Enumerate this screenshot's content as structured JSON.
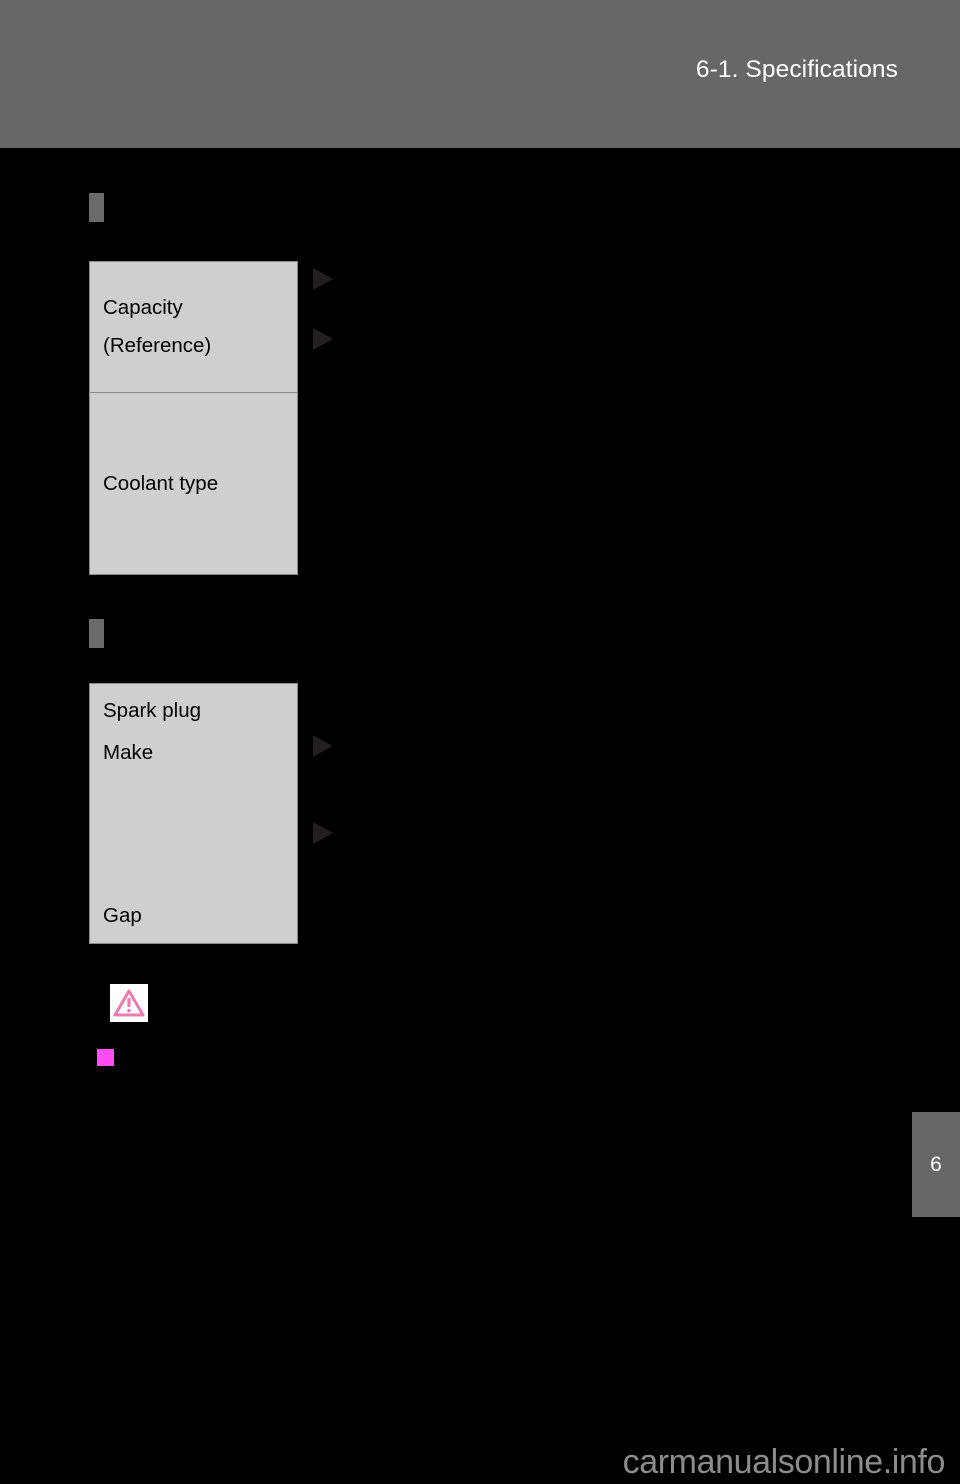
{
  "page": {
    "header_title": "6-1. Specifications",
    "chapter_tab": "6",
    "watermark": "carmanualsonline.info"
  },
  "sections": [
    {
      "id": "cooling-system",
      "marker": "",
      "rows": [
        {
          "label_line1": "Capacity",
          "label_line2": "(Reference)"
        },
        {
          "label_line1": "Coolant type",
          "label_line2": ""
        }
      ],
      "value_arrows": [
        "",
        ""
      ]
    },
    {
      "id": "ignition-system",
      "marker": "",
      "rows": [
        {
          "label_line1": "Spark plug",
          "label_line2": "Make"
        },
        {
          "label_line1": "Gap",
          "label_line2": ""
        }
      ],
      "value_arrows": [
        "",
        ""
      ]
    }
  ],
  "notices": {
    "warning_icon_label": "",
    "notice_square_label": ""
  }
}
